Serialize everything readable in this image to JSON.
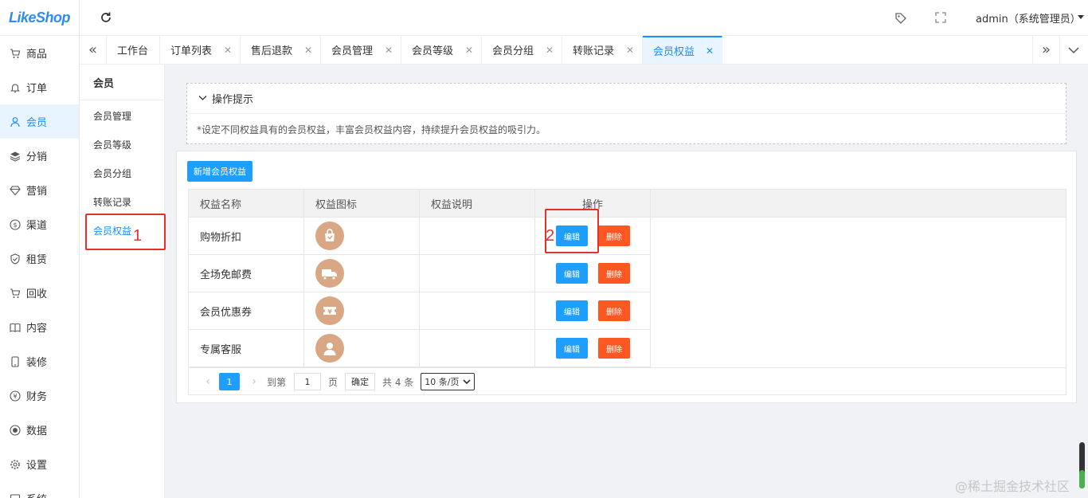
{
  "logo": "LikeShop",
  "nav": [
    {
      "label": "商品",
      "icon": "cart-icon"
    },
    {
      "label": "订单",
      "icon": "bell-icon"
    },
    {
      "label": "会员",
      "icon": "user-icon",
      "active": true
    },
    {
      "label": "分销",
      "icon": "layers-icon"
    },
    {
      "label": "营销",
      "icon": "diamond-icon"
    },
    {
      "label": "渠道",
      "icon": "dollar-icon"
    },
    {
      "label": "租赁",
      "icon": "shield-icon"
    },
    {
      "label": "回收",
      "icon": "cart-icon"
    },
    {
      "label": "内容",
      "icon": "book-icon"
    },
    {
      "label": "装修",
      "icon": "phone-icon"
    },
    {
      "label": "财务",
      "icon": "yen-icon"
    },
    {
      "label": "数据",
      "icon": "globe-icon"
    },
    {
      "label": "设置",
      "icon": "gear-icon"
    },
    {
      "label": "系统",
      "icon": "system-icon"
    }
  ],
  "header": {
    "user": "admin（系统管理员）"
  },
  "tabs": [
    {
      "label": "工作台",
      "closable": false
    },
    {
      "label": "订单列表",
      "closable": true
    },
    {
      "label": "售后退款",
      "closable": true
    },
    {
      "label": "会员管理",
      "closable": true
    },
    {
      "label": "会员等级",
      "closable": true
    },
    {
      "label": "会员分组",
      "closable": true
    },
    {
      "label": "转账记录",
      "closable": true
    },
    {
      "label": "会员权益",
      "closable": true,
      "active": true
    }
  ],
  "subnav": {
    "title": "会员",
    "items": [
      "会员管理",
      "会员等级",
      "会员分组",
      "转账记录",
      "会员权益"
    ],
    "active_index": 4
  },
  "annotations": {
    "num1": "1",
    "num2": "2"
  },
  "tips": {
    "title": "操作提示",
    "body": "*设定不同权益具有的会员权益，丰富会员权益内容，持续提升会员权益的吸引力。"
  },
  "toolbar": {
    "add_label": "新增会员权益"
  },
  "table": {
    "headers": [
      "权益名称",
      "权益图标",
      "权益说明",
      "操作"
    ],
    "rows": [
      {
        "name": "购物折扣",
        "icon": "shopping-bag-icon",
        "desc": ""
      },
      {
        "name": "全场免邮费",
        "icon": "truck-icon",
        "desc": ""
      },
      {
        "name": "会员优惠券",
        "icon": "coupon-icon",
        "desc": ""
      },
      {
        "name": "专属客服",
        "icon": "customer-service-icon",
        "desc": ""
      }
    ],
    "edit_label": "编辑",
    "delete_label": "删除"
  },
  "pager": {
    "current": "1",
    "goto_label": "到第",
    "goto_value": "1",
    "page_label": "页",
    "confirm_label": "确定",
    "total": "共 4 条",
    "page_size": "10 条/页"
  },
  "watermark": "@稀土掘金技术社区",
  "colors": {
    "primary": "#1e9fff",
    "danger": "#ff5722",
    "annotation": "#e8302a",
    "icon_bg": "#d9a783"
  }
}
